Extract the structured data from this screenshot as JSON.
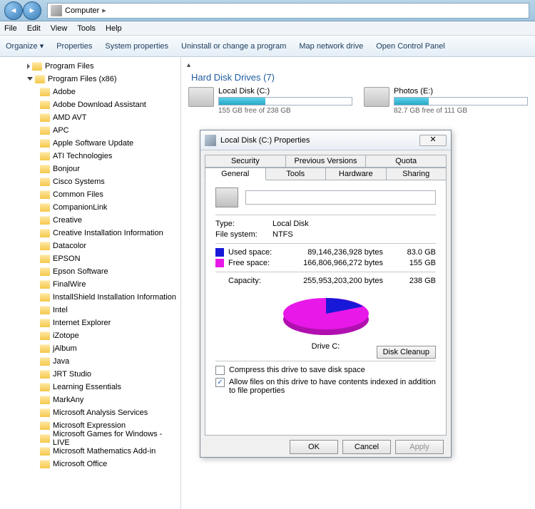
{
  "breadcrumb": "Computer",
  "menubar": [
    "File",
    "Edit",
    "View",
    "Tools",
    "Help"
  ],
  "toolbar": {
    "organize": "Organize",
    "items": [
      "Properties",
      "System properties",
      "Uninstall or change a program",
      "Map network drive",
      "Open Control Panel"
    ]
  },
  "tree": {
    "top": [
      {
        "label": "Program Files",
        "expanded": false
      },
      {
        "label": "Program Files (x86)",
        "expanded": true
      }
    ],
    "children": [
      "Adobe",
      "Adobe Download Assistant",
      "AMD AVT",
      "APC",
      "Apple Software Update",
      "ATI Technologies",
      "Bonjour",
      "Cisco Systems",
      "Common Files",
      "CompanionLink",
      "Creative",
      "Creative Installation Information",
      "Datacolor",
      "EPSON",
      "Epson Software",
      "FinalWire",
      "InstallShield Installation Information",
      "Intel",
      "Internet Explorer",
      "iZotope",
      "jAlbum",
      "Java",
      "JRT Studio",
      "Learning Essentials",
      "MarkAny",
      "Microsoft Analysis Services",
      "Microsoft Expression",
      "Microsoft Games for Windows - LIVE",
      "Microsoft Mathematics Add-in",
      "Microsoft Office"
    ]
  },
  "section_header": "Hard Disk Drives (7)",
  "drives": [
    {
      "name": "Local Disk (C:)",
      "free": "155 GB free of 238 GB",
      "pct": 35
    },
    {
      "name": "Photos (E:)",
      "free": "82.7 GB free of 111 GB",
      "pct": 26
    }
  ],
  "dialog": {
    "title": "Local Disk (C:) Properties",
    "tabs_top": [
      "Security",
      "Previous Versions",
      "Quota"
    ],
    "tabs_bot": [
      "General",
      "Tools",
      "Hardware",
      "Sharing"
    ],
    "active_tab": "General",
    "type_label": "Type:",
    "type_value": "Local Disk",
    "fs_label": "File system:",
    "fs_value": "NTFS",
    "used_label": "Used space:",
    "used_bytes": "89,146,236,928 bytes",
    "used_gb": "83.0 GB",
    "free_label": "Free space:",
    "free_bytes": "166,806,966,272 bytes",
    "free_gb": "155 GB",
    "cap_label": "Capacity:",
    "cap_bytes": "255,953,203,200 bytes",
    "cap_gb": "238 GB",
    "drive_label": "Drive C:",
    "cleanup": "Disk Cleanup",
    "compress": "Compress this drive to save disk space",
    "index": "Allow files on this drive to have contents indexed in addition to file properties",
    "ok": "OK",
    "cancel": "Cancel",
    "apply": "Apply"
  },
  "chart_data": {
    "type": "pie",
    "title": "Drive C:",
    "series": [
      {
        "name": "Used space",
        "value": 89146236928,
        "gb": 83.0,
        "color": "#1818d8"
      },
      {
        "name": "Free space",
        "value": 166806966272,
        "gb": 155,
        "color": "#e818e8"
      }
    ],
    "total": {
      "bytes": 255953203200,
      "gb": 238
    }
  }
}
